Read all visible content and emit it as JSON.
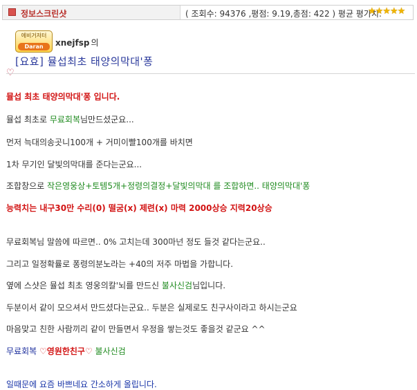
{
  "header": {
    "title": "정보스크린샷",
    "stats": "( 조회수: 94376 ,평점: 9.19,총점: 422 ) 평균 평가치:",
    "rating_stars": "★★★★★",
    "rating_color": "#f0b400"
  },
  "author": {
    "badge_top": "에비거저터",
    "badge_bottom": "Daran",
    "name": "xnejfsp",
    "suffix": "의"
  },
  "post": {
    "title": "[요효] 뮬섭최초 태양의막대'퐁",
    "heart": "♡",
    "lines": {
      "l1": "뮬섭 최초 태양의막대'퐁 입니다.",
      "l2a": "뮬섭 최초로 ",
      "l2b": "무료회복",
      "l2c": "님만드셨군요...",
      "l3": "먼저 늑대의송곳니100개 + 거미이빨100개를 바치면",
      "l4": "1차 무기인 달빛의막대를 준다는군요...",
      "l5a": "조합창으로 ",
      "l5b": "작은영웅상+토템5개+정령의결정+달빛의막대 를 조합하면.. 태양의막대'퐁",
      "l6": "능력치는 내구30만 수리(0)  떨굼(x) 제련(x) 마력 2000상승 지력20상승",
      "l7": "무료회복님 말씀에 따르면.. 0% 고치는데 300마넌 정도 들것 같다는군요..",
      "l8": "그리고 일정확률로 퐁령의분노라는 +40의 저주 마법을 가합니다.",
      "l9a": "옆에 스샷은 뮬섭 최초 영웅의칼'뇌를 만드신 ",
      "l9b": "불사신검",
      "l9c": "님입니다.",
      "l10": "두분이서 같이 모으셔서 만드셨다는군요.. 두분은 실제로도 친구사이라고 하시는군요",
      "l11": "마음맞고 친한 사람끼리 같이 만들면서 우정을 쌓는것도 좋을것 같군요 ^^",
      "l12a": "무료회복 ",
      "l12b": "♡영원한친구♡",
      "l12c": " 불사신검",
      "l13": "일때문에 요즘 바쁘네요 간소하게 올립니다."
    }
  }
}
